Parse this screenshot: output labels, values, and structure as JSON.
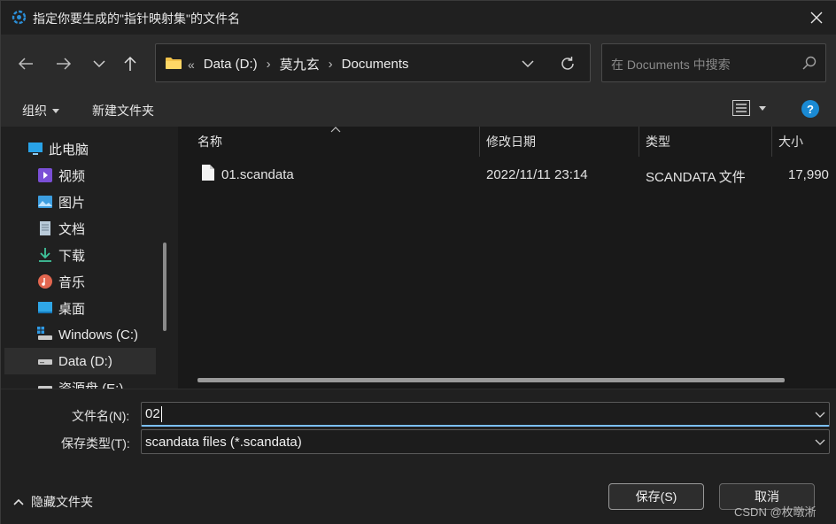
{
  "title": "指定你要生成的\"指针映射集\"的文件名",
  "nav": {
    "breadcrumb": [
      "Data (D:)",
      "莫九玄",
      "Documents"
    ],
    "overflow_marker": "«",
    "search_placeholder": "在 Documents 中搜索"
  },
  "toolbar": {
    "organize_label": "组织",
    "new_folder_label": "新建文件夹",
    "help_label": "?"
  },
  "sidebar": {
    "items": [
      {
        "label": "此电脑",
        "icon": "computer-icon"
      },
      {
        "label": "视频",
        "icon": "video-icon"
      },
      {
        "label": "图片",
        "icon": "pictures-icon"
      },
      {
        "label": "文档",
        "icon": "documents-icon"
      },
      {
        "label": "下载",
        "icon": "download-icon"
      },
      {
        "label": "音乐",
        "icon": "music-icon"
      },
      {
        "label": "桌面",
        "icon": "desktop-icon"
      },
      {
        "label": "Windows (C:)",
        "icon": "drive-icon"
      },
      {
        "label": "Data (D:)",
        "icon": "drive-icon"
      },
      {
        "label": "资源盘 (E:)",
        "icon": "drive-icon"
      }
    ],
    "selected_index": 8
  },
  "files": {
    "columns": [
      "名称",
      "修改日期",
      "类型",
      "大小"
    ],
    "rows": [
      {
        "name": "01.scandata",
        "modified": "2022/11/11 23:14",
        "type": "SCANDATA 文件",
        "size": "17,990"
      }
    ]
  },
  "form": {
    "filename_label": "文件名(N):",
    "filename_value": "02",
    "filetype_label": "保存类型(T):",
    "filetype_value": "scandata files (*.scandata)"
  },
  "footer": {
    "hide_folders_label": "隐藏文件夹",
    "save_label": "保存(S)",
    "cancel_label": "取消",
    "watermark": "CSDN @枚暾淅"
  },
  "colors": {
    "accent": "#1a8ad4",
    "focus": "#7cc0ff",
    "folder": "#f2c24b"
  }
}
